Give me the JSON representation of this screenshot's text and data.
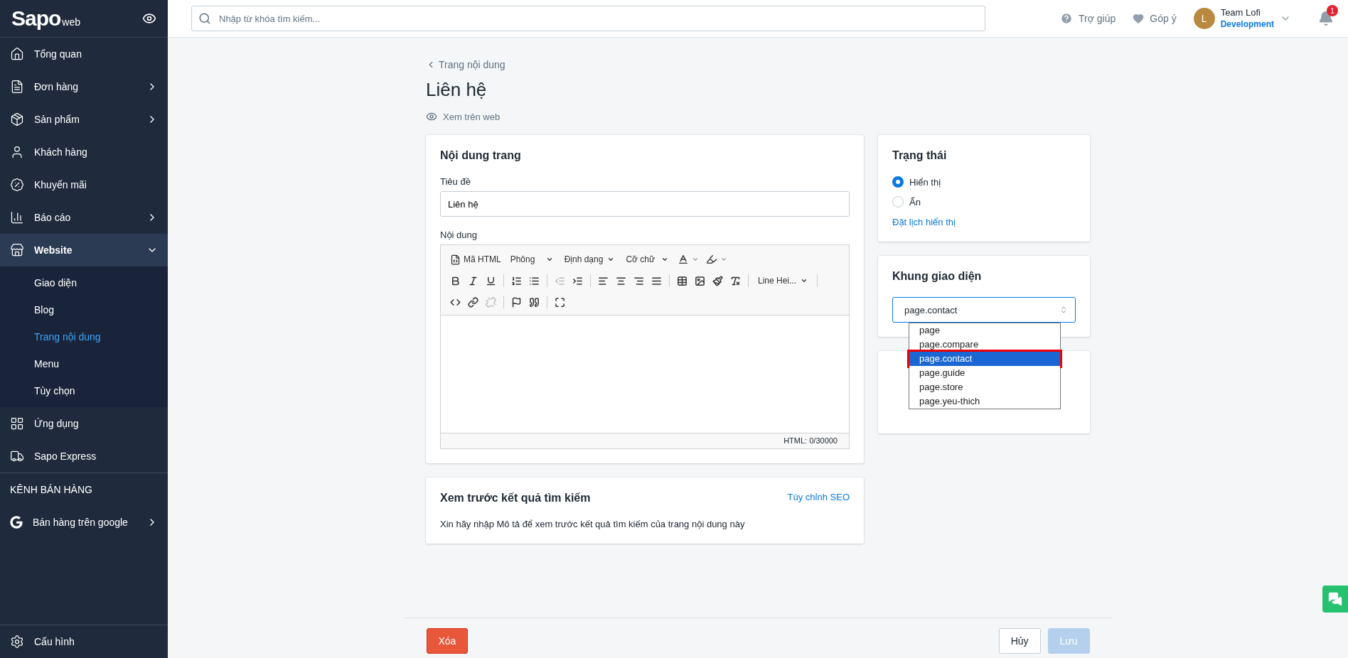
{
  "sidebar": {
    "brand": "Sapo",
    "brand_suffix": "web",
    "items": [
      {
        "label": "Tổng quan",
        "kind": "link",
        "selected": false
      },
      {
        "label": "Đơn hàng",
        "kind": "group",
        "expanded": false,
        "selected": false
      },
      {
        "label": "Sản phẩm",
        "kind": "group",
        "expanded": false,
        "selected": false
      },
      {
        "label": "Khách hàng",
        "kind": "link",
        "selected": false
      },
      {
        "label": "Khuyến mãi",
        "kind": "link",
        "selected": false
      },
      {
        "label": "Báo cáo",
        "kind": "group",
        "expanded": false,
        "selected": false
      },
      {
        "label": "Website",
        "kind": "group",
        "expanded": true,
        "selected": true,
        "children": [
          {
            "label": "Giao diện",
            "selected": false
          },
          {
            "label": "Blog",
            "selected": false
          },
          {
            "label": "Trang nội dung",
            "selected": true
          },
          {
            "label": "Menu",
            "selected": false
          },
          {
            "label": "Tùy chọn",
            "selected": false
          }
        ]
      },
      {
        "label": "Ứng dụng",
        "kind": "link",
        "selected": false
      },
      {
        "label": "Sapo Express",
        "kind": "link",
        "selected": false
      }
    ],
    "section_title": "KÊNH BÁN HÀNG",
    "channel_items": [
      {
        "label": "Bán hàng trên google",
        "kind": "group",
        "expanded": false,
        "selected": false
      }
    ],
    "footer_item": "Cấu hình"
  },
  "top_bar": {
    "search": {
      "placeholder": "Nhập từ khóa tìm kiếm..."
    },
    "help": "Trợ giúp",
    "feedback": "Góp ý",
    "user": {
      "initial": "L",
      "name": "Team Lofi",
      "role": "Development"
    },
    "notifications": "1"
  },
  "header": {
    "back_link": "Trang nội dung",
    "title": "Liên hệ",
    "view_link": "Xem trên web"
  },
  "content_card": {
    "title": "Nội dung trang",
    "title_label": "Tiêu đề",
    "title_value": "Liên hệ",
    "content_label": "Nội dung",
    "toolbar": [
      [
        {
          "kind": "html",
          "label": "Mã HTML"
        },
        {
          "kind": "dropdown",
          "label": "Phông"
        },
        {
          "kind": "dropdown",
          "label": "Định dạng"
        },
        {
          "kind": "dropdown",
          "label": "Cỡ chữ"
        },
        {
          "kind": "text-color"
        },
        {
          "kind": "background-color"
        }
      ],
      [
        {
          "kind": "bold",
          "disabled": false
        },
        {
          "kind": "italic",
          "disabled": false
        },
        {
          "kind": "underline",
          "disabled": false
        },
        {
          "kind": "separator"
        },
        {
          "kind": "ordered-list",
          "disabled": false
        },
        {
          "kind": "bullet-list",
          "disabled": false
        },
        {
          "kind": "separator"
        },
        {
          "kind": "outdent",
          "disabled": true
        },
        {
          "kind": "indent",
          "disabled": false
        },
        {
          "kind": "separator"
        },
        {
          "kind": "align-left",
          "disabled": false
        },
        {
          "kind": "align-center",
          "disabled": false
        },
        {
          "kind": "align-right",
          "disabled": false
        },
        {
          "kind": "justify",
          "disabled": false
        },
        {
          "kind": "separator"
        },
        {
          "kind": "table",
          "disabled": false
        },
        {
          "kind": "image",
          "disabled": false
        },
        {
          "kind": "brush",
          "disabled": false
        },
        {
          "kind": "clear-format",
          "disabled": false
        },
        {
          "kind": "separator"
        },
        {
          "kind": "dropdown",
          "label": "Line Hei..."
        },
        {
          "kind": "separator"
        }
      ],
      [
        {
          "kind": "code",
          "disabled": false
        },
        {
          "kind": "link",
          "disabled": false
        },
        {
          "kind": "unlink",
          "disabled": true
        },
        {
          "kind": "separator"
        },
        {
          "kind": "flag",
          "disabled": false
        },
        {
          "kind": "quote",
          "disabled": false
        },
        {
          "kind": "separator"
        },
        {
          "kind": "fullscreen",
          "disabled": false
        }
      ]
    ],
    "counter": "HTML: 0/30000"
  },
  "seo_card": {
    "title": "Xem trước kết quả tìm kiếm",
    "link": "Tùy chỉnh SEO",
    "text": "Xin hãy nhập Mô tả để xem trước kết quả tìm kiếm của trang nội dung này"
  },
  "status_card": {
    "title": "Trạng thái",
    "options": [
      {
        "label": "Hiển thị",
        "selected": true
      },
      {
        "label": "Ẩn",
        "selected": false
      }
    ],
    "schedule_link": "Đặt lịch hiển thị"
  },
  "template_card": {
    "title": "Khung giao diện",
    "value": "page.contact",
    "open": true,
    "options": [
      {
        "label": "page",
        "selected": false
      },
      {
        "label": "page.compare",
        "selected": false
      },
      {
        "label": "page.contact",
        "selected": true
      },
      {
        "label": "page.guide",
        "selected": false
      },
      {
        "label": "page.store",
        "selected": false
      },
      {
        "label": "page.yeu-thich",
        "selected": false
      }
    ]
  },
  "footer": {
    "delete": "Xóa",
    "cancel": "Hủy",
    "save": "Lưu",
    "save_disabled": true
  }
}
